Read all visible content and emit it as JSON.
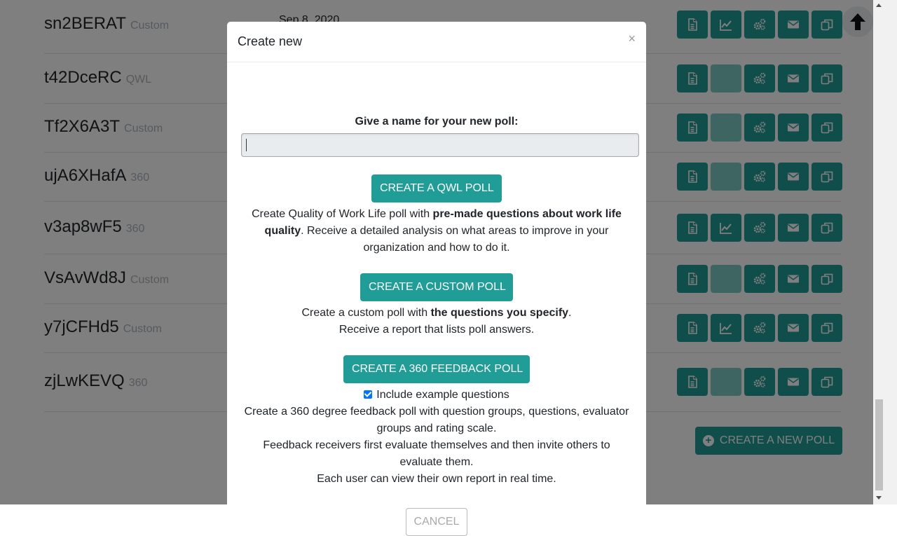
{
  "list": {
    "rows": [
      {
        "name": "sn2BERAT",
        "type": "Custom",
        "date": "Sep 8, 2020",
        "chart_enabled": true
      },
      {
        "name": "t42DceRC",
        "type": "QWL",
        "date": "",
        "chart_enabled": false
      },
      {
        "name": "Tf2X6A3T",
        "type": "Custom",
        "date": "",
        "chart_enabled": false
      },
      {
        "name": "ujA6XHafA",
        "type": "360",
        "date": "",
        "chart_enabled": false
      },
      {
        "name": "v3ap8wF5",
        "type": "360",
        "date": "",
        "chart_enabled": true
      },
      {
        "name": "VsAvWd8J",
        "type": "Custom",
        "date": "",
        "chart_enabled": false
      },
      {
        "name": "y7jCFHd5",
        "type": "Custom",
        "date": "",
        "chart_enabled": true
      },
      {
        "name": "zjLwKEVQ",
        "type": "360",
        "date": "",
        "chart_enabled": false
      }
    ],
    "create_new_label": "CREATE A NEW POLL",
    "action_icons": [
      "document-icon",
      "chart-icon",
      "cogs-icon",
      "envelope-icon",
      "copy-icon"
    ]
  },
  "modal": {
    "title": "Create new",
    "close_glyph": "×",
    "name_label": "Give a name for your new poll:",
    "name_value": "",
    "qwl": {
      "button": "CREATE A QWL POLL",
      "desc_1": "Create Quality of Work Life poll with ",
      "desc_bold": "pre-made questions about work life quality",
      "desc_2": ". Receive a detailed analysis on what areas to improve in your organization and how to do it."
    },
    "custom": {
      "button": "CREATE A CUSTOM POLL",
      "desc_1": "Create a custom poll with ",
      "desc_bold": "the questions you specify",
      "desc_2": ".",
      "desc_line2": "Receive a report that lists poll answers."
    },
    "feedback360": {
      "button": "CREATE A 360 FEEDBACK POLL",
      "checkbox_label": "Include example questions",
      "checkbox_checked": true,
      "desc_line1": "Create a 360 degree feedback poll with question groups, questions, evaluator groups and rating scale.",
      "desc_line2": "Feedback receivers first evaluate themselves and then invite others to evaluate them.",
      "desc_line3": "Each user can view their own report in real time."
    },
    "cancel": "CANCEL"
  },
  "colors": {
    "accent": "#1f9d96",
    "accent_disabled": "#7ecbc6"
  }
}
